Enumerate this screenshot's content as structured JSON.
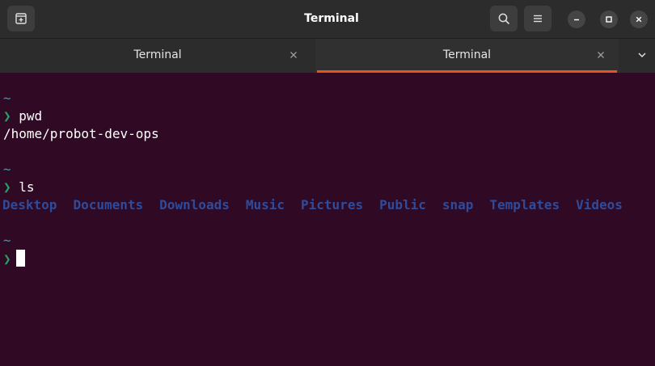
{
  "window": {
    "title": "Terminal"
  },
  "header": {
    "new_tab_icon": "new-tab-icon",
    "search_icon": "search-icon",
    "menu_icon": "hamburger-menu-icon",
    "minimize_icon": "minimize-icon",
    "maximize_icon": "maximize-icon",
    "close_icon": "close-icon"
  },
  "tabs": [
    {
      "label": "Terminal",
      "active": false
    },
    {
      "label": "Terminal",
      "active": true
    }
  ],
  "terminal": {
    "tilde": "~",
    "prompt_symbol": "❯",
    "blocks": [
      {
        "command": "pwd",
        "output": "/home/probot-dev-ops"
      },
      {
        "command": "ls",
        "dirs": [
          "Desktop",
          "Documents",
          "Downloads",
          "Music",
          "Pictures",
          "Public",
          "snap",
          "Templates",
          "Videos"
        ]
      }
    ]
  },
  "colors": {
    "background": "#300a24",
    "accent": "#e95420",
    "tilde": "#2aa1b3",
    "prompt": "#26a269",
    "directory": "#2e4b9c"
  }
}
